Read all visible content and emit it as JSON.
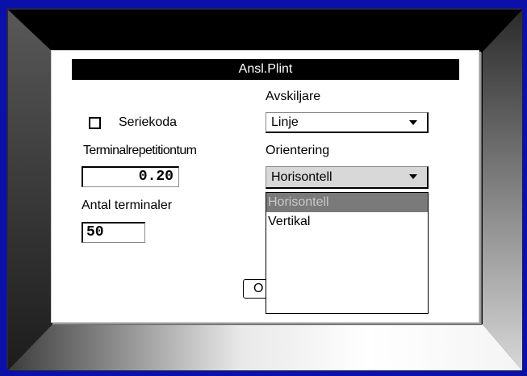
{
  "dialog": {
    "title": "Ansl.Plint",
    "serial_checkbox": {
      "label": "Seriekoda",
      "checked": false
    },
    "separator": {
      "label": "Avskiljare",
      "value": "Linje"
    },
    "terminal_pitch": {
      "label": "Terminalrepetitiontum",
      "value": "0.20"
    },
    "orientation": {
      "label": "Orientering",
      "value": "Horisontell",
      "options": [
        "Horisontell",
        "Vertikal"
      ],
      "highlighted": "Horisontell"
    },
    "terminal_count": {
      "label": "Antal terminaler",
      "value": "50"
    },
    "ok_button": {
      "label": "O"
    }
  },
  "colors": {
    "background": "#0b10a8",
    "bezel": "#000000",
    "titlebar": "#000000",
    "dropdown_highlight": "#7a7a7a"
  }
}
